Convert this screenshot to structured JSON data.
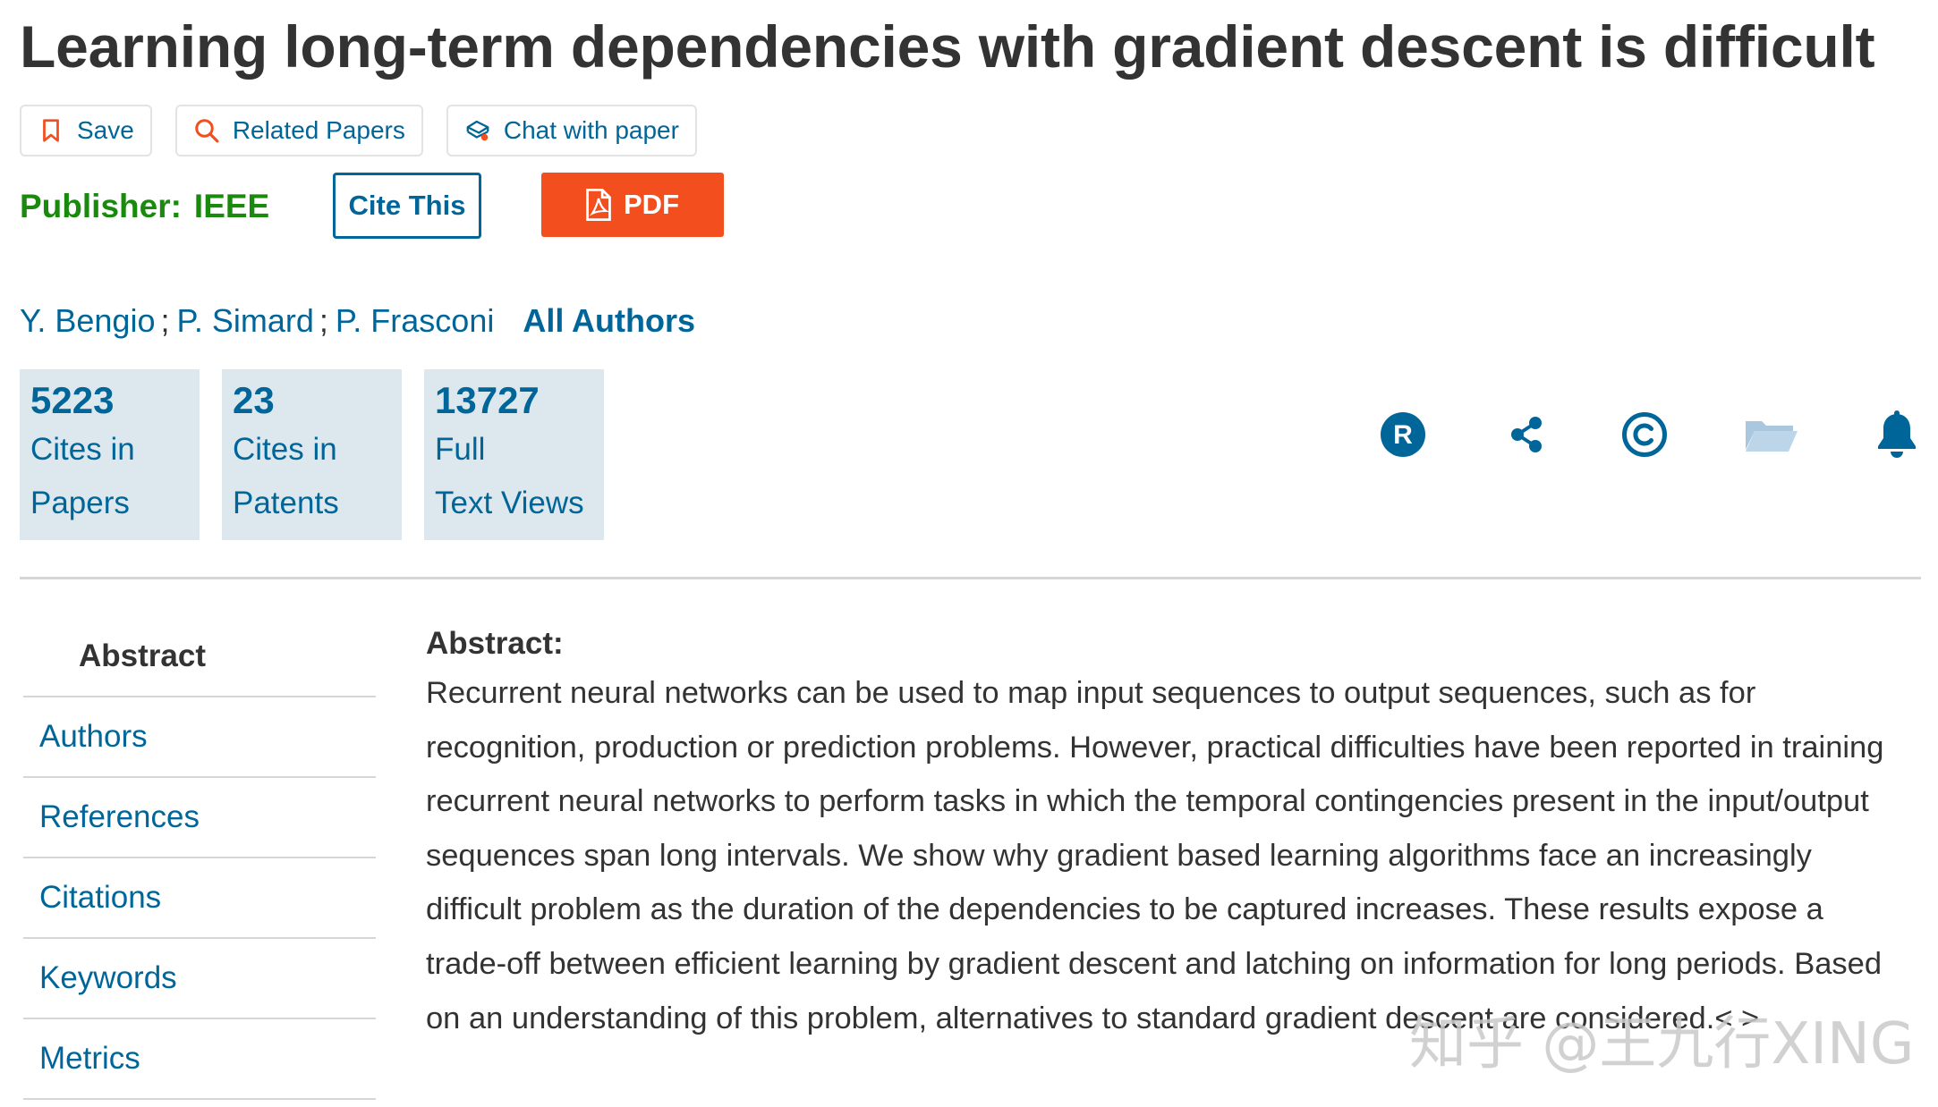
{
  "title": "Learning long-term dependencies with gradient descent is difficult",
  "toolbar": {
    "save": "Save",
    "related": "Related Papers",
    "chat": "Chat with paper"
  },
  "publisher": {
    "label": "Publisher:",
    "name": "IEEE"
  },
  "buttons": {
    "cite": "Cite This",
    "pdf": "PDF"
  },
  "authors": {
    "list": [
      "Y. Bengio",
      "P. Simard",
      "P. Frasconi"
    ],
    "separator": ";",
    "all": "All Authors"
  },
  "metrics": [
    {
      "value": "5223",
      "line1": "Cites in",
      "line2": "Papers"
    },
    {
      "value": "23",
      "line1": "Cites in",
      "line2": "Patents"
    },
    {
      "value": "13727",
      "line1": "Full",
      "line2": "Text Views"
    }
  ],
  "actions": {
    "rights_letter": "R",
    "icons": [
      "rights-permissions-icon",
      "share-icon",
      "copyright-icon",
      "folder-icon",
      "bell-icon"
    ]
  },
  "sidebar": {
    "items": [
      "Abstract",
      "Authors",
      "References",
      "Citations",
      "Keywords",
      "Metrics"
    ]
  },
  "abstract": {
    "heading": "Abstract:",
    "text": "Recurrent neural networks can be used to map input sequences to output sequences, such as for recognition, production or prediction problems. However, practical difficulties have been reported in training recurrent neural networks to perform tasks in which the temporal contingencies present in the input/output sequences span long intervals. We show why gradient based learning algorithms face an increasingly difficult problem as the duration of the dependencies to be captured increases. These results expose a trade-off between efficient learning by gradient descent and latching on information for long periods. Based on an understanding of this problem, alternatives to standard gradient descent are considered.< >"
  },
  "watermark": "知乎 @王九行XING",
  "colors": {
    "link": "#006699",
    "publisher": "#1a8a0e",
    "pdf": "#f34e1d",
    "stat_bg": "#dde8ee",
    "folder": "#a9c7df"
  }
}
